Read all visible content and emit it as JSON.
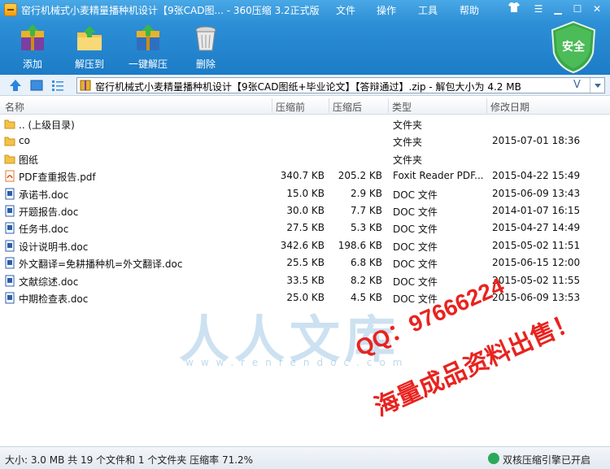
{
  "window": {
    "title": "窑行机械式小麦精量播种机设计【9张CAD图... - 360压缩 3.2正式版",
    "menu": [
      "文件",
      "操作",
      "工具",
      "帮助"
    ],
    "controls": [
      "☰",
      "▁",
      "☐",
      "✕"
    ]
  },
  "toolbar": {
    "add_label": "添加",
    "extract_to_label": "解压到",
    "one_click_label": "一键解压",
    "delete_label": "删除",
    "security_label": "安全"
  },
  "address": {
    "path": "窑行机械式小麦精量播种机设计【9张CAD图纸+毕业论文】【答辩通过】.zip - 解包大小为 4.2 MB",
    "v_mark": "V"
  },
  "columns": {
    "name": "名称",
    "size_before": "压缩前",
    "size_after": "压缩后",
    "type": "类型",
    "modified": "修改日期"
  },
  "files": [
    {
      "icon": "folder-icon",
      "name": ".. (上级目录)",
      "before": "",
      "after": "",
      "type": "文件夹",
      "date": ""
    },
    {
      "icon": "folder-icon",
      "name": "cο",
      "before": "",
      "after": "",
      "type": "文件夹",
      "date": "2015-07-01 18:36"
    },
    {
      "icon": "folder-icon",
      "name": "图纸",
      "before": "",
      "after": "",
      "type": "文件夹",
      "date": ""
    },
    {
      "icon": "pdf-icon",
      "name": "PDF查重报告.pdf",
      "before": "340.7 KB",
      "after": "205.2 KB",
      "type": "Foxit Reader PDF...",
      "date": "2015-04-22 15:49"
    },
    {
      "icon": "doc-icon",
      "name": "承诺书.doc",
      "before": "15.0 KB",
      "after": "2.9 KB",
      "type": "DOC 文件",
      "date": "2015-06-09 13:43"
    },
    {
      "icon": "doc-icon",
      "name": "开题报告.doc",
      "before": "30.0 KB",
      "after": "7.7 KB",
      "type": "DOC 文件",
      "date": "2014-01-07 16:15"
    },
    {
      "icon": "doc-icon",
      "name": "任务书.doc",
      "before": "27.5 KB",
      "after": "5.3 KB",
      "type": "DOC 文件",
      "date": "2015-04-27 14:49"
    },
    {
      "icon": "doc-icon",
      "name": "设计说明书.doc",
      "before": "342.6 KB",
      "after": "198.6 KB",
      "type": "DOC 文件",
      "date": "2015-05-02 11:51"
    },
    {
      "icon": "doc-icon",
      "name": "外文翻译=免耕播种机=外文翻译.doc",
      "before": "25.5 KB",
      "after": "6.8 KB",
      "type": "DOC 文件",
      "date": "2015-06-15 12:00"
    },
    {
      "icon": "doc-icon",
      "name": "文献综述.doc",
      "before": "33.5 KB",
      "after": "8.2 KB",
      "type": "DOC 文件",
      "date": "2015-05-02 11:55"
    },
    {
      "icon": "doc-icon",
      "name": "中期检查表.doc",
      "before": "25.0 KB",
      "after": "4.5 KB",
      "type": "DOC 文件",
      "date": "2015-06-09 13:53"
    }
  ],
  "watermark": {
    "brand": "人人文库",
    "url": "www.renrendoc.com",
    "qq": "QQ：97666224",
    "sale": "海量成品资料出售！"
  },
  "status": {
    "summary": "大小: 3.0 MB 共 19 个文件和 1 个文件夹 压缩率 71.2%",
    "engine": "双核压缩引擎已开启"
  },
  "colors": {
    "toolbar_blue": "#1c7cc7",
    "watermark_red": "#e8231f",
    "shield_green": "#3aa848"
  }
}
